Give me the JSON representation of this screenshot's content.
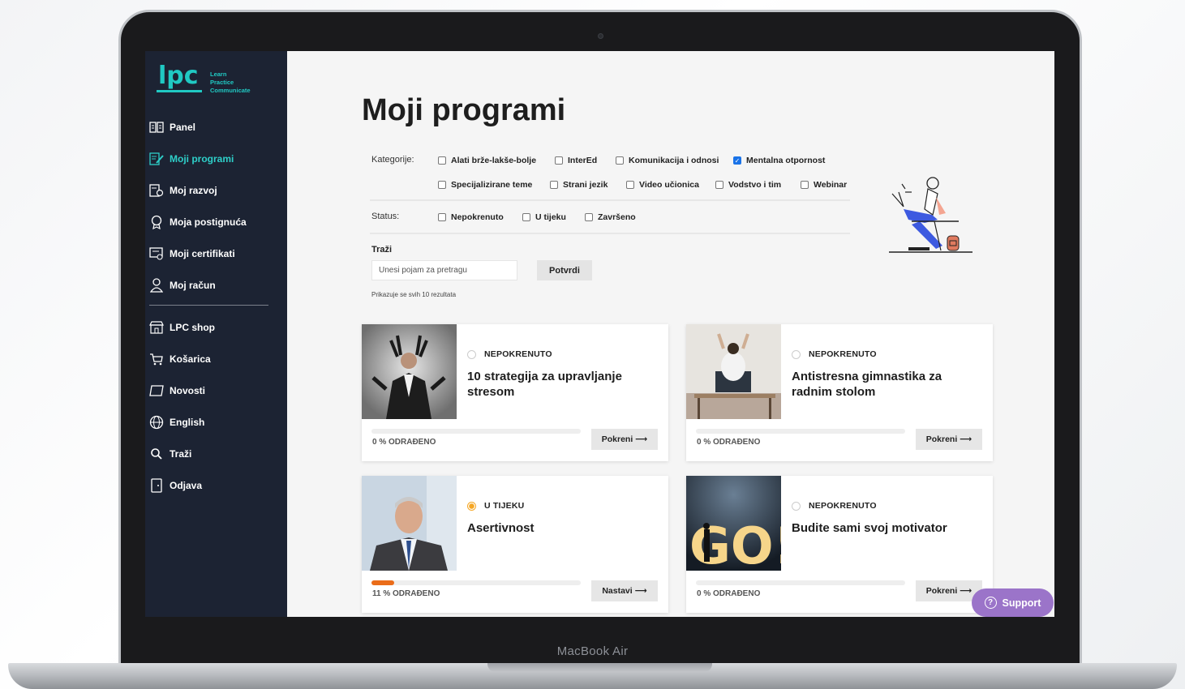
{
  "device": {
    "label": "MacBook Air"
  },
  "logo": {
    "text": "lpc",
    "tagline": [
      "Learn",
      "Practice",
      "Communicate"
    ]
  },
  "sidebar": {
    "items": [
      {
        "label": "Panel",
        "icon": "book-icon",
        "active": false
      },
      {
        "label": "Moji programi",
        "icon": "edit-doc-icon",
        "active": true
      },
      {
        "label": "Moj razvoj",
        "icon": "progress-doc-icon",
        "active": false
      },
      {
        "label": "Moja postignuća",
        "icon": "medal-icon",
        "active": false
      },
      {
        "label": "Moji certifikati",
        "icon": "certificate-icon",
        "active": false
      },
      {
        "label": "Moj račun",
        "icon": "user-icon",
        "active": false
      },
      {
        "label": "LPC shop",
        "icon": "shop-icon",
        "active": false
      },
      {
        "label": "Košarica",
        "icon": "cart-icon",
        "active": false
      },
      {
        "label": "Novosti",
        "icon": "news-icon",
        "active": false
      },
      {
        "label": "English",
        "icon": "globe-icon",
        "active": false
      },
      {
        "label": "Traži",
        "icon": "search-icon",
        "active": false
      },
      {
        "label": "Odjava",
        "icon": "logout-icon",
        "active": false
      }
    ]
  },
  "main": {
    "title": "Moji programi",
    "categories_label": "Kategorije:",
    "categories": [
      {
        "label": "Alati brže-lakše-bolje",
        "checked": false
      },
      {
        "label": "InterEd",
        "checked": false
      },
      {
        "label": "Komunikacija i odnosi",
        "checked": false
      },
      {
        "label": "Mentalna otpornost",
        "checked": true
      },
      {
        "label": "Specijalizirane teme",
        "checked": false
      },
      {
        "label": "Strani jezik",
        "checked": false
      },
      {
        "label": "Video učionica",
        "checked": false
      },
      {
        "label": "Vodstvo i tim",
        "checked": false
      },
      {
        "label": "Webinar",
        "checked": false
      }
    ],
    "status_label": "Status:",
    "statuses": [
      {
        "label": "Nepokrenuto",
        "checked": false
      },
      {
        "label": "U tijeku",
        "checked": false
      },
      {
        "label": "Završeno",
        "checked": false
      }
    ],
    "search": {
      "label": "Traži",
      "placeholder": "Unesi pojam za pretragu",
      "button": "Potvrdi"
    },
    "results_note": "Prikazuje se svih 10 rezultata",
    "cards": [
      {
        "status": "NEPOKRENUTO",
        "title": "10 strategija za upravljanje stresom",
        "progress": 0,
        "progress_label": "0 % ODRAĐENO",
        "button": "Pokreni ⟶",
        "thumb": "stressed-businessman"
      },
      {
        "status": "NEPOKRENUTO",
        "title": "Antistresna gimnastika za radnim stolom",
        "progress": 0,
        "progress_label": "0 % ODRAĐENO",
        "button": "Pokreni ⟶",
        "thumb": "desk-stretch"
      },
      {
        "status": "U TIJEKU",
        "title": "Asertivnost",
        "progress": 11,
        "progress_label": "11 % ODRAĐENO",
        "button": "Nastavi ⟶",
        "thumb": "businessman-portrait"
      },
      {
        "status": "NEPOKRENUTO",
        "title": "Budite sami svoj motivator",
        "progress": 0,
        "progress_label": "0 % ODRAĐENO",
        "button": "Pokreni ⟶",
        "thumb": "go-sign"
      }
    ]
  },
  "support": {
    "label": "Support"
  },
  "colors": {
    "sidebar": "#1c2333",
    "accent": "#2ecfc9",
    "progress": "#ea6c19",
    "support": "#9b74c9",
    "checked": "#1a73e8"
  }
}
